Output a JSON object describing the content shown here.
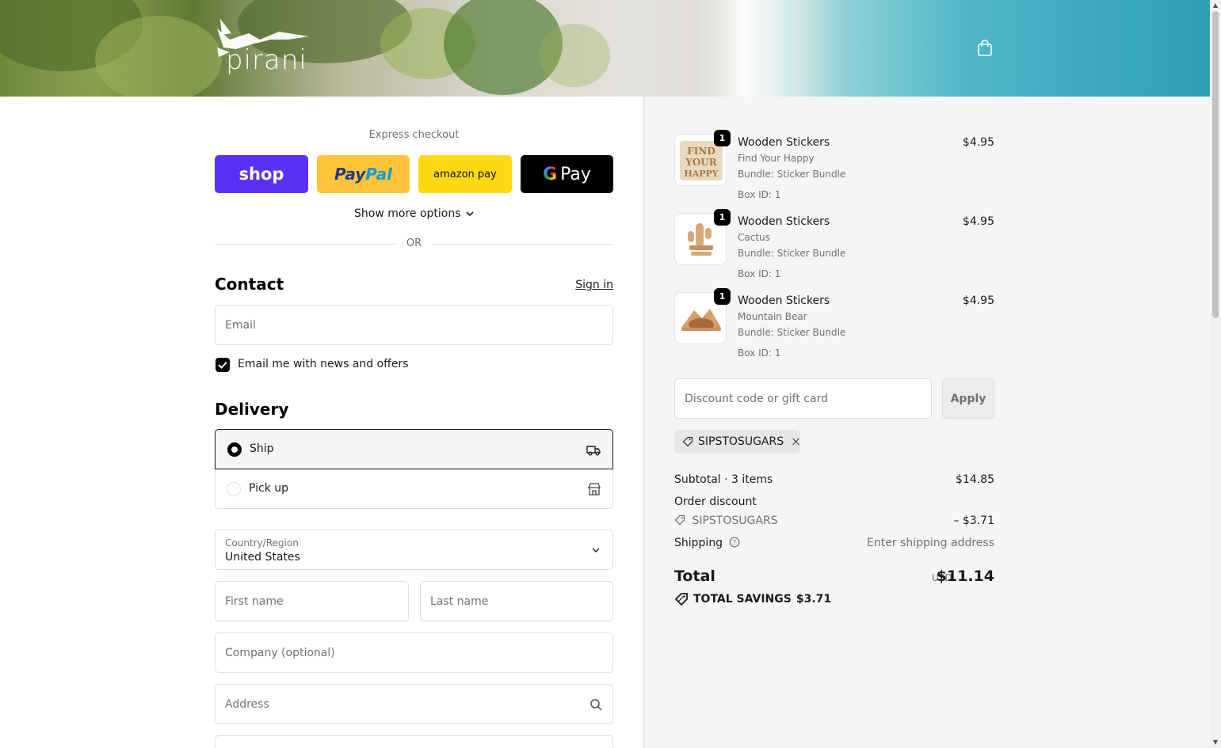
{
  "header": {
    "brand": "pirani",
    "cart_icon": "shopping-bag-icon"
  },
  "express": {
    "title": "Express checkout",
    "buttons": {
      "shop": "shop",
      "paypal_a": "Pay",
      "paypal_b": "Pal",
      "amazon": "amazon pay",
      "gpay_g": "G",
      "gpay": "Pay"
    },
    "more_options": "Show more options",
    "or": "OR"
  },
  "contact": {
    "title": "Contact",
    "sign_in": "Sign in",
    "email_placeholder": "Email",
    "newsletter_label": "Email me with news and offers",
    "newsletter_checked": true
  },
  "delivery": {
    "title": "Delivery",
    "options": [
      {
        "label": "Ship",
        "selected": true,
        "icon": "truck-icon"
      },
      {
        "label": "Pick up",
        "selected": false,
        "icon": "store-icon"
      }
    ],
    "country_label": "Country/Region",
    "country_value": "United States",
    "first_name": "First name",
    "last_name": "Last name",
    "company": "Company (optional)",
    "address": "Address"
  },
  "cart": {
    "items": [
      {
        "name": "Wooden Stickers",
        "variant": "Find Your Happy",
        "bundle": "Bundle: Sticker Bundle",
        "box": "Box ID: 1",
        "price": "$4.95",
        "qty": "1"
      },
      {
        "name": "Wooden Stickers",
        "variant": "Cactus",
        "bundle": "Bundle: Sticker Bundle",
        "box": "Box ID: 1",
        "price": "$4.95",
        "qty": "1"
      },
      {
        "name": "Wooden Stickers",
        "variant": "Mountain Bear",
        "bundle": "Bundle: Sticker Bundle",
        "box": "Box ID: 1",
        "price": "$4.95",
        "qty": "1"
      }
    ],
    "thumb_text": "FIND YOUR HAPPY",
    "discount_placeholder": "Discount code or gift card",
    "apply_label": "Apply",
    "applied_code": "SIPSTOSUGARS"
  },
  "summary": {
    "subtotal_label": "Subtotal · 3 items",
    "subtotal_value": "$14.85",
    "order_discount_label": "Order discount",
    "discount_code": "SIPSTOSUGARS",
    "discount_value": "– $3.71",
    "shipping_label": "Shipping",
    "shipping_value": "Enter shipping address",
    "total_label": "Total",
    "currency": "USD",
    "total_value": "$11.14",
    "savings_label": "TOTAL SAVINGS",
    "savings_value": "$3.71"
  },
  "colors": {
    "shop": "#5a31f4",
    "paypal": "#ffc439",
    "amazon": "#ffd814",
    "gpay": "#000000",
    "summary_bg": "#f5f5f5"
  }
}
